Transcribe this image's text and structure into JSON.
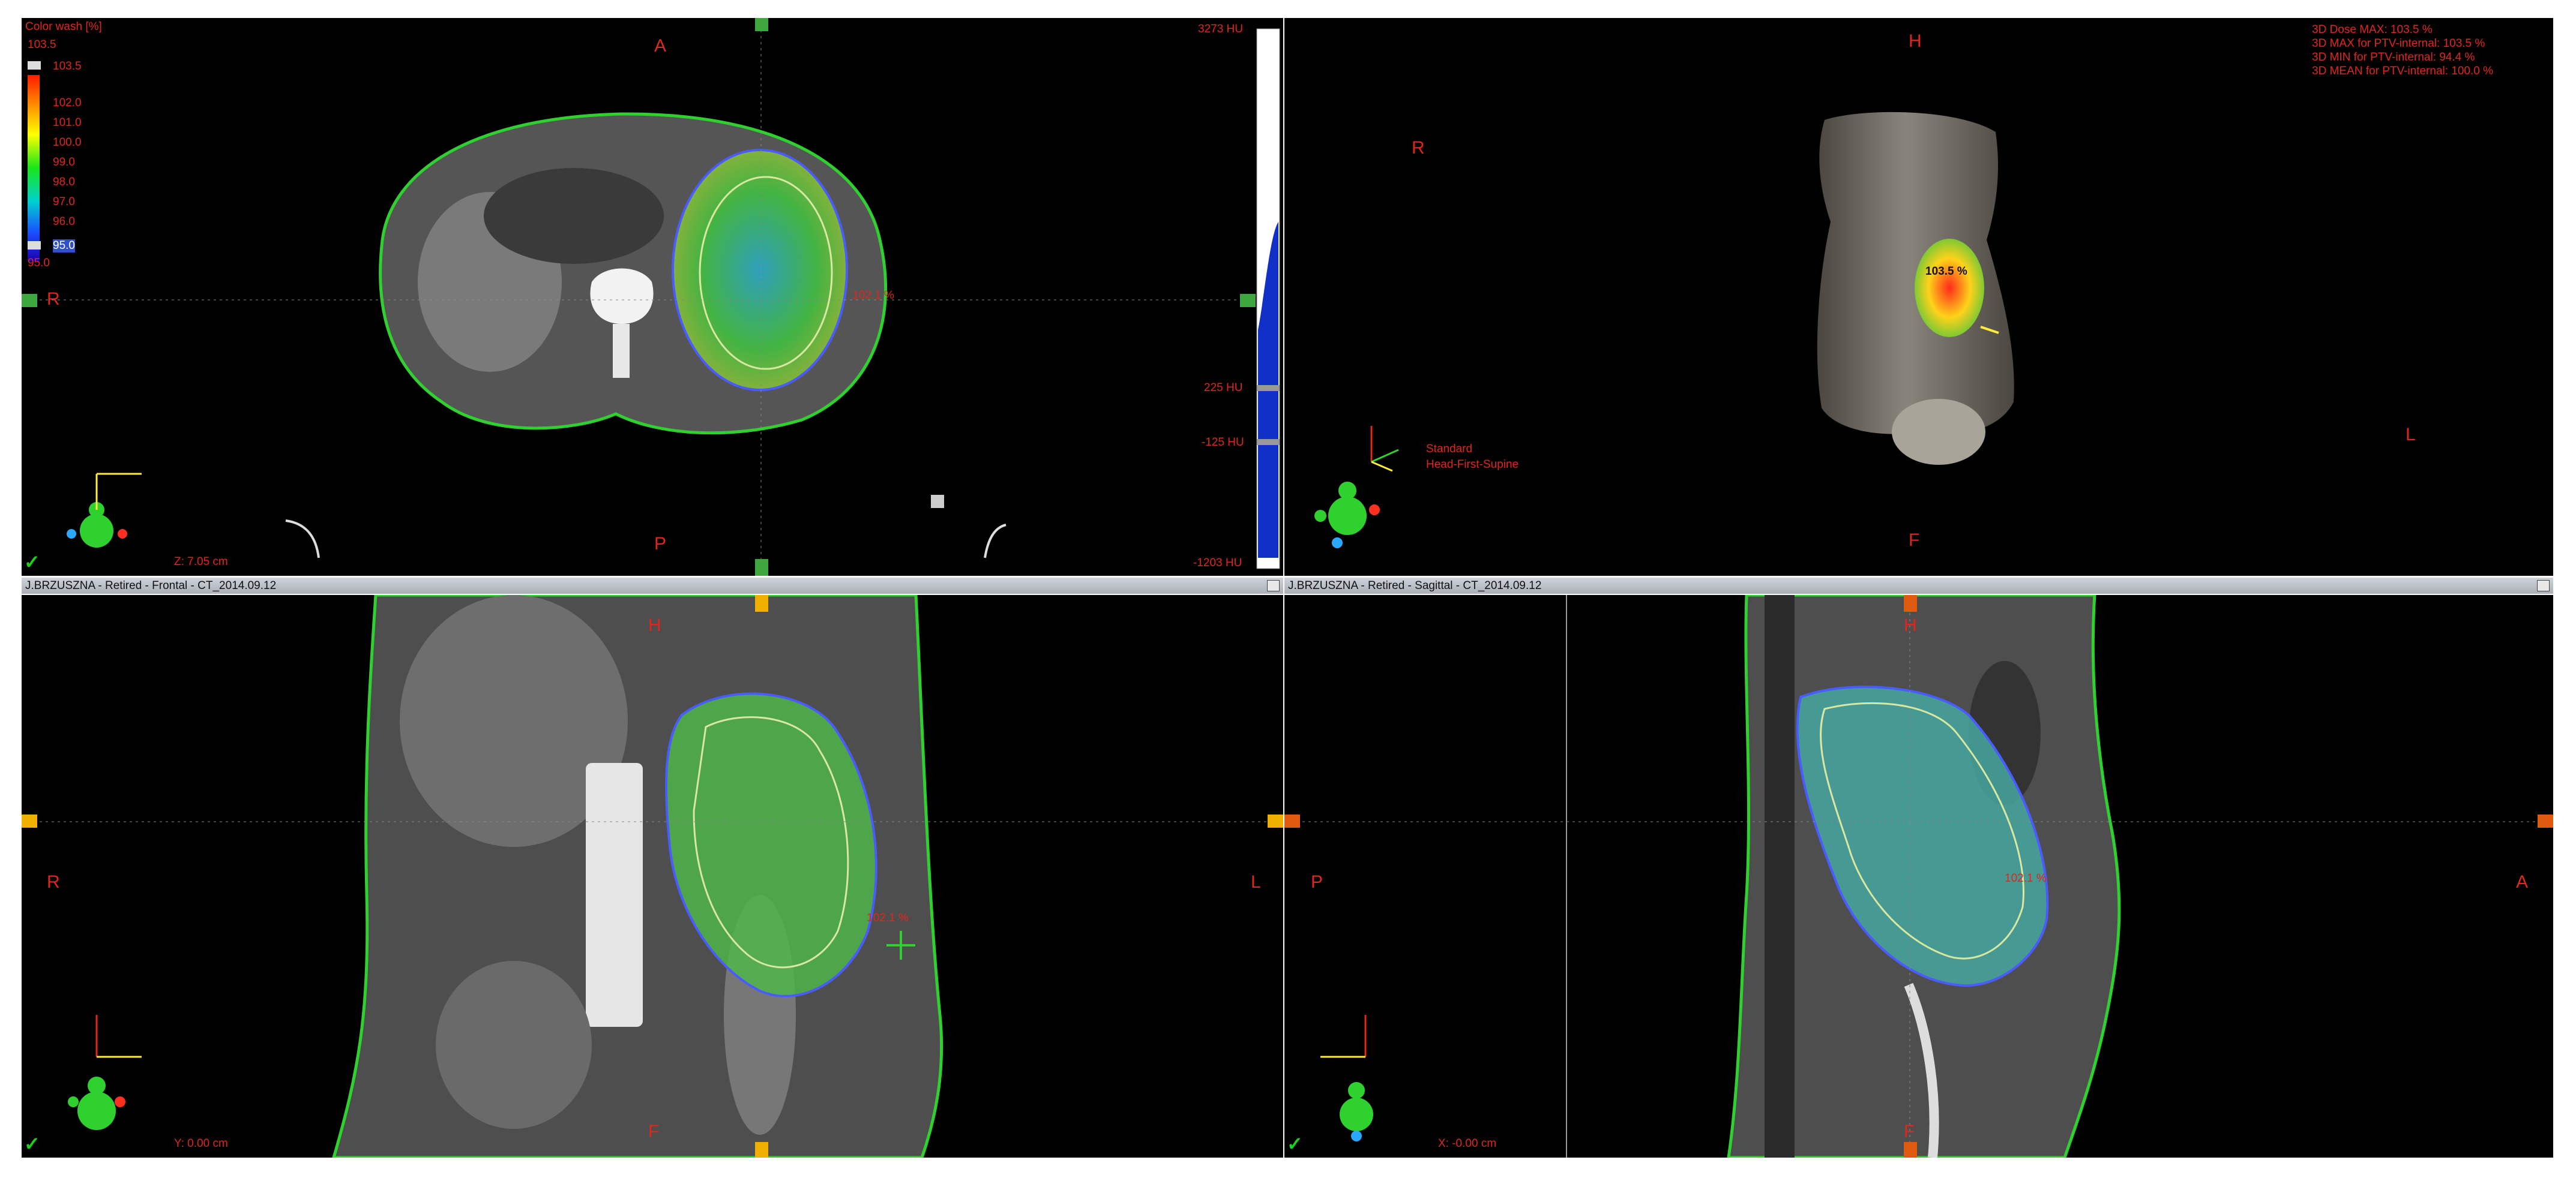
{
  "axial": {
    "colorwash_title": "Color wash [%]",
    "colorwash_max_top": "103.5",
    "colorwash_upper_handle": "103.5",
    "colorwash_ticks": [
      "102.0",
      "101.0",
      "100.0",
      "99.0",
      "98.0",
      "97.0",
      "96.0"
    ],
    "colorwash_lower_handle": "95.0",
    "colorwash_min_bottom": "95.0",
    "orient_top": "A",
    "orient_left": "R",
    "orient_bottom": "P",
    "point_dose": "102.1 %",
    "position": "Z: 7.05 cm",
    "hu_top": "3273 HU",
    "hu_225": "225 HU",
    "hu_neg125": "-125 HU",
    "hu_bottom": "-1203 HU"
  },
  "view3d": {
    "orient_top": "H",
    "orient_left": "R",
    "orient_right": "L",
    "orient_bottom": "F",
    "stats": [
      "3D Dose MAX: 103.5 %",
      "3D MAX for PTV-internal: 103.5 %",
      "3D MIN for PTV-internal: 94.4 %",
      "3D MEAN for PTV-internal: 100.0 %"
    ],
    "max_marker": "103.5 %",
    "orientation_line1": "Standard",
    "orientation_line2": "Head-First-Supine"
  },
  "frontal": {
    "title": "J.BRZUSZNA  -  Retired - Frontal - CT_2014.09.12",
    "orient_top": "H",
    "orient_left": "R",
    "orient_right": "L",
    "orient_bottom": "F",
    "point_dose": "102.1 %",
    "position": "Y: 0.00 cm"
  },
  "sagittal": {
    "title": "J.BRZUSZNA  -  Retired - Sagittal - CT_2014.09.12",
    "orient_top": "H",
    "orient_left": "P",
    "orient_right": "A",
    "orient_bottom": "F",
    "point_dose": "102.1 %",
    "position": "X: -0.00 cm"
  },
  "colors": {
    "label": "#e0261d",
    "body_contour": "#2fd12f",
    "ptv_contour": "#4a5cff",
    "titlebar": "#b9bec7"
  }
}
